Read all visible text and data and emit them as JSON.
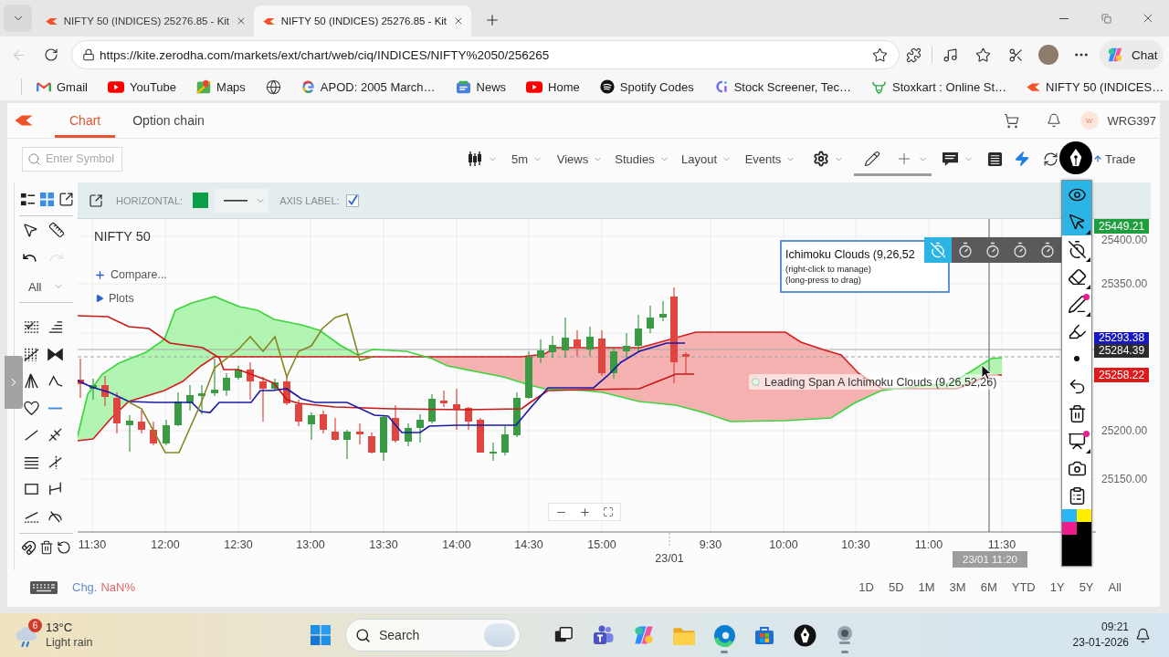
{
  "browser": {
    "back": {
      "disabled": true
    },
    "tabs": [
      {
        "title": "NIFTY 50 (INDICES) 25276.85 - Kit",
        "selected": false
      },
      {
        "title": "NIFTY 50 (INDICES) 25276.85 - Kit",
        "selected": true
      }
    ],
    "url": "https://kite.zerodha.com/markets/ext/chart/web/ciq/INDICES/NIFTY%2050/256265",
    "chat_label": "Chat",
    "bookmarks": [
      {
        "kind": "link",
        "label": "Gmail"
      },
      {
        "kind": "link",
        "label": "YouTube"
      },
      {
        "kind": "link",
        "label": "Maps"
      },
      {
        "kind": "icon"
      },
      {
        "kind": "link",
        "label": "APOD: 2005 March…"
      },
      {
        "kind": "link",
        "label": "News"
      },
      {
        "kind": "link",
        "label": "Home"
      },
      {
        "kind": "link",
        "label": "Spotify Codes"
      },
      {
        "kind": "link",
        "label": "Stock Screener, Tec…"
      },
      {
        "kind": "link",
        "label": "Stoxkart : Online St…"
      },
      {
        "kind": "link",
        "label": "NIFTY 50 (INDICES…"
      }
    ]
  },
  "kite": {
    "tabs": [
      {
        "label": "Chart",
        "selected": true
      },
      {
        "label": "Option chain",
        "selected": false
      }
    ],
    "user": {
      "initial": "W",
      "id": "WRG397"
    }
  },
  "toolbar": {
    "search": {
      "placeholder": "Enter Symbol"
    },
    "interval": "5m",
    "menus": [
      "Views",
      "Studies",
      "Layout",
      "Events"
    ],
    "drawing_active": true,
    "trade_label": "Trade"
  },
  "side_panel": {
    "views": [
      {
        "selected": false
      },
      {
        "selected": true
      }
    ],
    "history": [
      {
        "disabled": false
      },
      {
        "disabled": true
      }
    ],
    "filter": "All",
    "tools": [
      {
        "selected": false
      },
      {
        "selected": false
      },
      {
        "selected": false
      },
      {
        "selected": false
      },
      {
        "selected": false
      },
      {
        "selected": false
      },
      {
        "selected": false
      },
      {
        "selected": true
      },
      {
        "selected": false
      },
      {
        "selected": false
      },
      {
        "selected": false
      },
      {
        "selected": false
      },
      {
        "selected": false
      },
      {
        "selected": false
      },
      {
        "selected": false
      },
      {
        "selected": false
      }
    ]
  },
  "drawing_settings": {
    "tool_label": "HORIZONTAL:",
    "color": "#0b9e48",
    "axis_label": "AXIS LABEL:",
    "axis_label_checked": true
  },
  "chart": {
    "title": "NIFTY 50",
    "compare": "Compare...",
    "plots": "Plots",
    "study_tooltip": {
      "title": "Ichimoku Clouds (9,26,52",
      "hints": [
        "(right-click to manage)",
        "(long-press to drag)"
      ]
    },
    "series_label": "Leading Span A Ichimoku Clouds (9,26,52,26)",
    "y_labels": [
      "25400.00",
      "25350.00",
      "25200.00",
      "25150.00"
    ],
    "price_tags": [
      {
        "value": "25449.21",
        "color": "#1e9e3e"
      },
      {
        "value": "25293.38",
        "color": "#1818c0"
      },
      {
        "value": "25284.39",
        "color": "#2b2b2b"
      },
      {
        "value": "25258.22",
        "color": "#e01a1a"
      }
    ],
    "x_labels": [
      "11:30",
      "12:00",
      "12:30",
      "13:00",
      "13:30",
      "14:00",
      "14:30",
      "15:00",
      "9:30",
      "10:00",
      "10:30",
      "11:00",
      "11:30"
    ],
    "date_label": "23/01",
    "crosshair_time": "23/01 11:20"
  },
  "overlay": {
    "tools": [
      {
        "selected": true
      },
      {
        "selected": true
      },
      {
        "selected": false
      },
      {
        "selected": false
      },
      {
        "selected": false
      },
      {
        "selected": false
      },
      {
        "selected": false
      },
      {
        "selected": false
      },
      {
        "selected": false
      },
      {
        "selected": false
      },
      {
        "selected": false
      },
      {
        "selected": false
      }
    ],
    "timers": [
      {
        "selected": true
      },
      {
        "selected": false
      },
      {
        "selected": false
      },
      {
        "selected": false
      },
      {
        "selected": false
      }
    ],
    "swatches": [
      {
        "color": "#29b6f6"
      },
      {
        "color": "#ffee00"
      },
      {
        "color": "#ec1c8c"
      },
      {
        "color": "#000000"
      },
      {
        "color": "#000000"
      }
    ]
  },
  "bottom_bar": {
    "change_label": "Chg.",
    "change_value": "NaN%",
    "ranges": [
      "1D",
      "5D",
      "1M",
      "3M",
      "6M",
      "YTD",
      "1Y",
      "5Y",
      "All"
    ]
  },
  "taskbar": {
    "weather": {
      "badge": "6",
      "temperature": "13°C",
      "condition": "Light rain"
    },
    "search": {
      "placeholder": "Search"
    },
    "apps": [
      {
        "running": false
      },
      {
        "running": false
      },
      {
        "running": false
      },
      {
        "running": false
      },
      {
        "running": true
      },
      {
        "running": false
      },
      {
        "running": false
      },
      {
        "running": true
      }
    ],
    "time": "09:21",
    "date": "23-01-2026"
  }
}
